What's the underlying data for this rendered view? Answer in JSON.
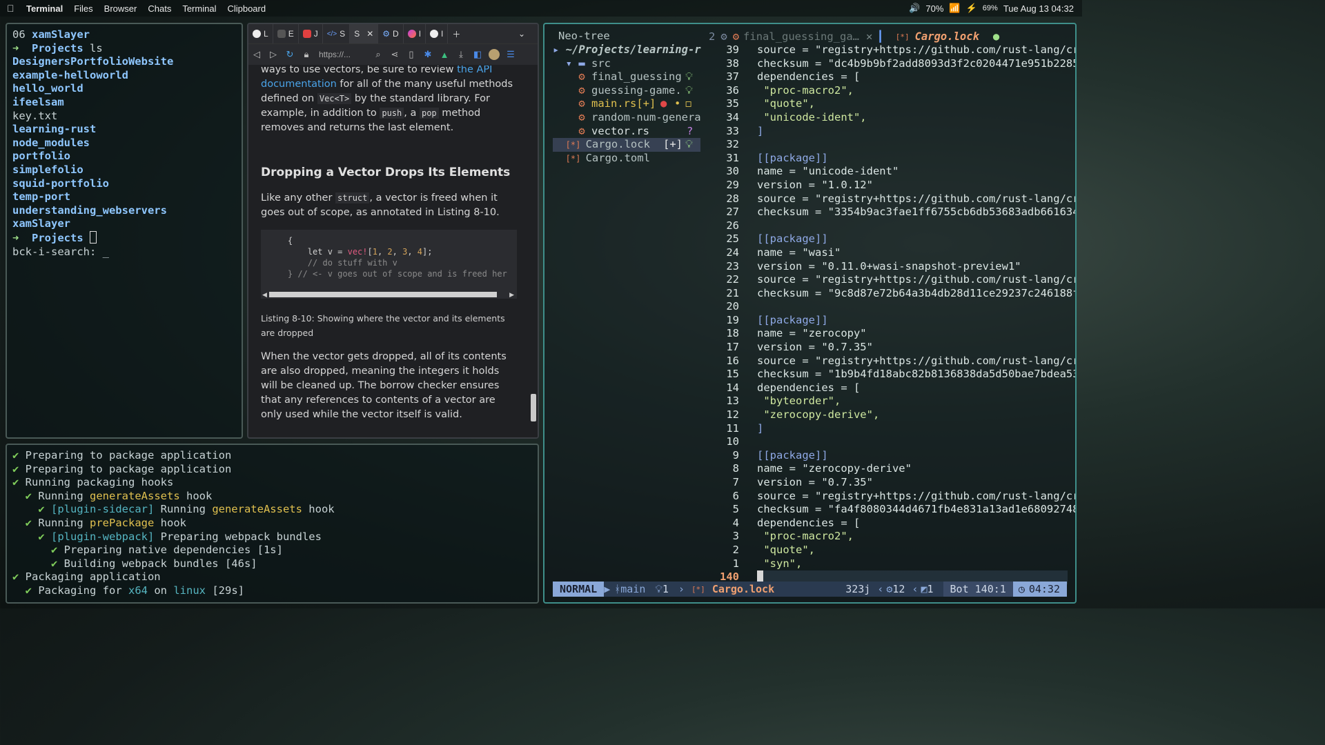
{
  "menubar": {
    "app_name": "Terminal",
    "items": [
      "Files",
      "Browser",
      "Chats",
      "Terminal",
      "Clipboard"
    ],
    "volume": "70%",
    "battery": "69%",
    "datetime": "Tue Aug 13 04:32"
  },
  "term1": {
    "lines": [
      {
        "type": "header",
        "num": "06",
        "name": "xamSlayer"
      },
      {
        "type": "prompt",
        "dir": "Projects",
        "cmd": "ls"
      },
      {
        "type": "dir",
        "text": "DesignersPortfolioWebsite"
      },
      {
        "type": "dir",
        "text": "example-helloworld"
      },
      {
        "type": "dir",
        "text": "hello_world"
      },
      {
        "type": "dir",
        "text": "ifeelsam"
      },
      {
        "type": "file",
        "text": "key.txt"
      },
      {
        "type": "dir",
        "text": "learning-rust"
      },
      {
        "type": "dir",
        "text": "node_modules"
      },
      {
        "type": "dir",
        "text": "portfolio"
      },
      {
        "type": "dir",
        "text": "simplefolio"
      },
      {
        "type": "dir",
        "text": "squid-portfolio"
      },
      {
        "type": "dir",
        "text": "temp-port"
      },
      {
        "type": "dir",
        "text": "understanding_webservers"
      },
      {
        "type": "dir",
        "text": "xamSlayer"
      }
    ],
    "prompt_dir": "Projects",
    "search_line": "bck-i-search: _"
  },
  "browser": {
    "tabs": [
      "L",
      "E",
      "J",
      "S",
      "S",
      "D",
      "I",
      "I"
    ],
    "url": "https://...",
    "para1_pre": "ways to use vectors, be sure to review ",
    "para1_link": "the API documentation",
    "para1_a": " for all of the many useful methods defined on ",
    "para1_code1": "Vec<T>",
    "para1_b": " by the standard library. For example, in addition to ",
    "para1_code2": "push",
    "para1_c": ", a ",
    "para1_code3": "pop",
    "para1_d": " method removes and returns the last element.",
    "heading": "Dropping a Vector Drops Its Elements",
    "para2_a": "Like any other ",
    "para2_code": "struct",
    "para2_b": ", a vector is freed when it goes out of scope, as annotated in Listing 8-10.",
    "code_lines": [
      "    {",
      "        let v = vec![1, 2, 3, 4];",
      "",
      "        // do stuff with v",
      "    } // <- v goes out of scope and is freed her"
    ],
    "caption": "Listing 8-10: Showing where the vector and its elements are dropped",
    "para3": "When the vector gets dropped, all of its contents are also dropped, meaning the integers it holds will be cleaned up. The borrow checker ensures that any references to contents of a vector are only used while the vector itself is valid."
  },
  "packager": {
    "l1": "Preparing to package application",
    "l2": "Preparing to package application",
    "l3": "Running packaging hooks",
    "l4_a": "Running ",
    "l4_hook": "generateAssets",
    "l4_b": " hook",
    "l5_plugin": "[plugin-sidecar]",
    "l5_a": " Running ",
    "l5_hook": "generateAssets",
    "l5_b": " hook",
    "l6_a": "Running ",
    "l6_hook": "prePackage",
    "l6_b": " hook",
    "l7_plugin": "[plugin-webpack]",
    "l7_a": " Preparing webpack bundles",
    "l8": "Preparing native dependencies [1s]",
    "l9": "Building webpack bundles [46s]",
    "l10": "Packaging application",
    "l11_a": "Packaging for ",
    "l11_arch": "x64",
    "l11_b": " on ",
    "l11_os": "linux",
    "l11_c": " [29s]"
  },
  "editor": {
    "neo_title": "Neo-tree",
    "buf_count": "2",
    "tab1": "final_guessing_ga…",
    "tab2": "Cargo.lock",
    "tree_root": "~/Projects/learning-r",
    "tree_src": "src",
    "tree_files": [
      {
        "name": "final_guessing",
        "mark": "💡"
      },
      {
        "name": "guessing-game.",
        "mark": "💡"
      },
      {
        "name": "main.rs[+]",
        "mark": "● ◻"
      },
      {
        "name": "random-num-genera",
        "mark": ""
      },
      {
        "name": "vector.rs",
        "mark": "?"
      }
    ],
    "tree_cargo_lock": "Cargo.lock",
    "tree_cargo_lock_mark": "[+] 💡",
    "tree_cargo_toml": "Cargo.toml",
    "line_numbers": [
      "39",
      "38",
      "37",
      "36",
      "35",
      "34",
      "33",
      "32",
      "31",
      "30",
      "29",
      "28",
      "27",
      "26",
      "25",
      "24",
      "23",
      "22",
      "21",
      "20",
      "19",
      "18",
      "17",
      "16",
      "15",
      "14",
      "13",
      "12",
      "11",
      "10",
      "9",
      "8",
      "7",
      "6",
      "5",
      "4",
      "3",
      "2",
      "1",
      "140"
    ],
    "code_lines": [
      "source = \"registry+https://github.com/rust-lang/cr",
      "checksum = \"dc4b9b9bf2add8093d3f2c0204471e951b2285",
      "dependencies = [",
      " \"proc-macro2\",",
      " \"quote\",",
      " \"unicode-ident\",",
      "]",
      "",
      "[[package]]",
      "name = \"unicode-ident\"",
      "version = \"1.0.12\"",
      "source = \"registry+https://github.com/rust-lang/cr",
      "checksum = \"3354b9ac3fae1ff6755cb6db53683adb661634",
      "",
      "[[package]]",
      "name = \"wasi\"",
      "version = \"0.11.0+wasi-snapshot-preview1\"",
      "source = \"registry+https://github.com/rust-lang/cr",
      "checksum = \"9c8d87e72b64a3b4db28d11ce29237c246188f",
      "",
      "[[package]]",
      "name = \"zerocopy\"",
      "version = \"0.7.35\"",
      "source = \"registry+https://github.com/rust-lang/cr",
      "checksum = \"1b9b4fd18abc82b8136838da5d50bae7bdea53",
      "dependencies = [",
      " \"byteorder\",",
      " \"zerocopy-derive\",",
      "]",
      "",
      "[[package]]",
      "name = \"zerocopy-derive\"",
      "version = \"0.7.35\"",
      "source = \"registry+https://github.com/rust-lang/cr",
      "checksum = \"fa4f8080344d4671fb4e831a13ad1e68092748",
      "dependencies = [",
      " \"proc-macro2\",",
      " \"quote\",",
      " \"syn\",",
      ""
    ],
    "status": {
      "mode": "NORMAL",
      "branch": "main",
      "hints": "1",
      "file": "Cargo.lock",
      "size": "323j",
      "errs": "12",
      "warn": "1",
      "pos": "Bot 140:1",
      "time": "04:32"
    }
  }
}
